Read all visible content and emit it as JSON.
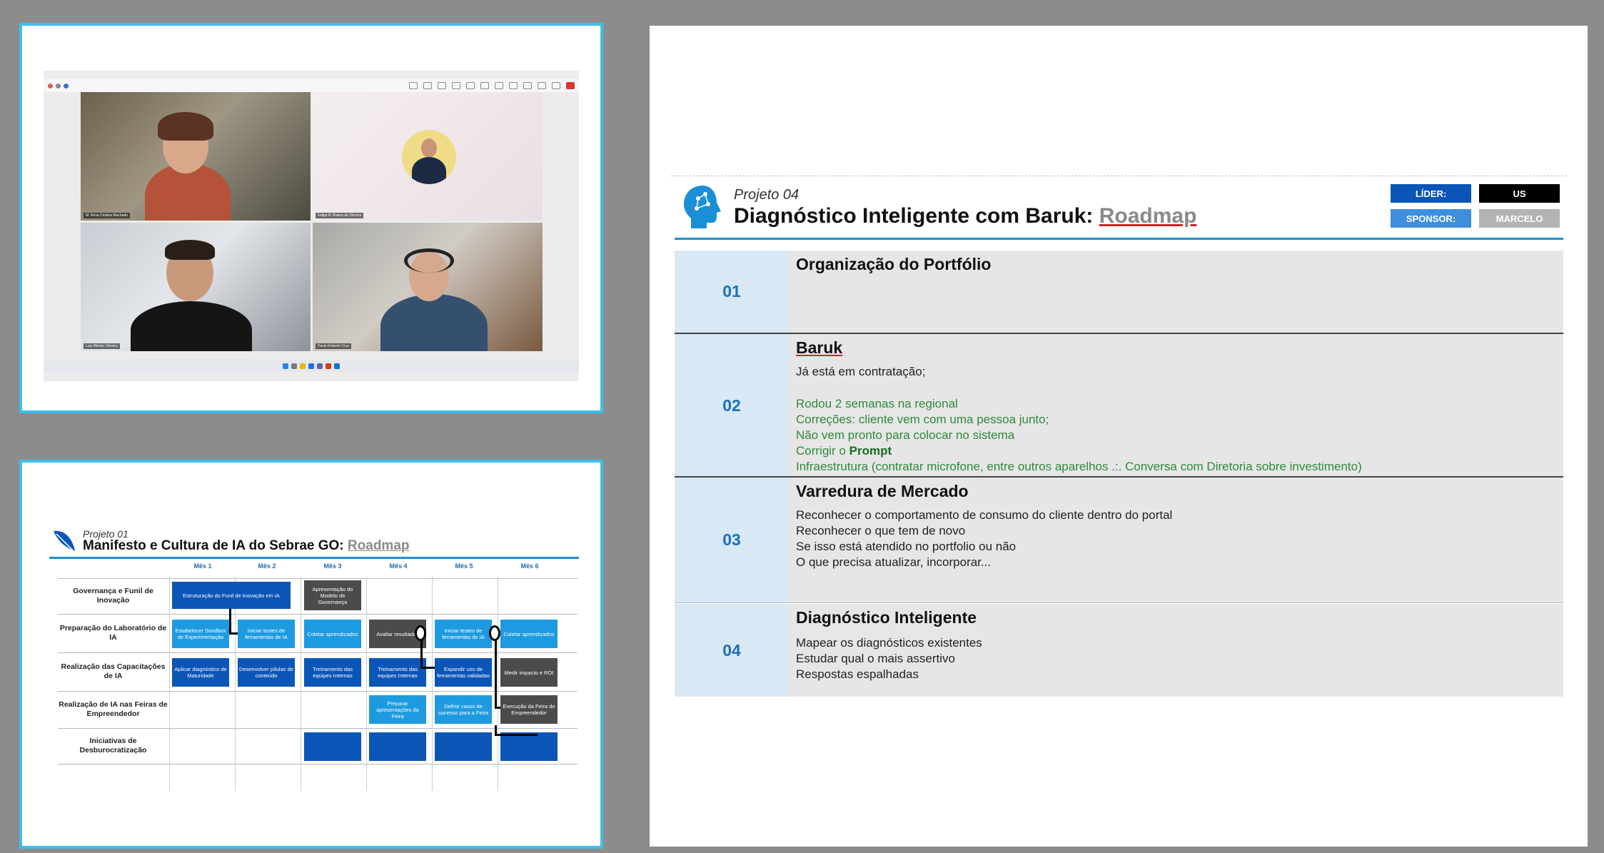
{
  "video_call": {
    "tiles": [
      {
        "label": "M. Rosa Cristina Machado"
      },
      {
        "label": "Felipe R. Bueno de Oliveira"
      },
      {
        "label": "Luis Ribeiro Oliveira"
      },
      {
        "label": "Paulo Roberto Cruz"
      }
    ]
  },
  "roadmap1": {
    "kicker": "Projeto 01",
    "title_main": "Manifesto e Cultura de IA do Sebrae GO: ",
    "title_roadmap": "Roadmap",
    "months": [
      "Mês 1",
      "Mês 2",
      "Mês 3",
      "Mês 4",
      "Mês 5",
      "Mês 6"
    ],
    "rows": [
      "Governança e Funil de Inovação",
      "Preparação do Laboratório de IA",
      "Realização das Capacitações de IA",
      "Realização de IA nas Feiras de Empreendedor",
      "Iniciativas de Desburocratização"
    ],
    "cells": [
      "Estruturação do Funil de Inovação em IA",
      "Apresentação do Modelo de Governança",
      "Estabelecer Sandbox de Experimentação",
      "Iniciar testes de ferramentas de IA",
      "Coletar aprendizados",
      "Avaliar resultados",
      "Iniciar testes de ferramentas de IA",
      "Coletar aprendizados",
      "Aplicar diagnóstico de Maturidade",
      "Desenvolver pílulas de conteúdo",
      "Treinamento das equipes Internas",
      "Treinamento das equipes Internas",
      "Expandir uso de ferramentas validadas",
      "Medir impacto e ROI",
      "Preparar apresentações da Feira",
      "Definir casos de sucesso para a Feira",
      "Execução da Feira do Empreendedor"
    ]
  },
  "slide": {
    "kicker": "Projeto 04",
    "title_main": "Diagnóstico Inteligente com Baruk: ",
    "title_roadmap": "Roadmap",
    "lider_label": "LÍDER:",
    "lider_value": "US",
    "sponsor_label": "SPONSOR:",
    "sponsor_value": "MARCELO",
    "sections": [
      {
        "num": "01",
        "title": "Organização do Portfólio"
      },
      {
        "num": "02",
        "title": "Baruk",
        "line1": "Já está em contratação;",
        "g1": "Rodou 2 semanas na regional",
        "g2": "Correções: cliente vem com uma pessoa junto;",
        "g3": "Não vem pronto para colocar no sistema",
        "g4a": "Corrigir o ",
        "g4b": "Prompt",
        "g5": "Infraestrutura (contratar microfone, entre outros aparelhos .:. Conversa com Diretoria sobre investimento)"
      },
      {
        "num": "03",
        "title": "Varredura de Mercado",
        "l1": "Reconhecer o comportamento de consumo do cliente dentro do portal",
        "l2": "Reconhecer o que tem de novo",
        "l3": "Se isso está atendido no portfolio ou não",
        "l4": "O que precisa atualizar, incorporar..."
      },
      {
        "num": "04",
        "title": "Diagnóstico Inteligente",
        "l1": "Mapear os diagnósticos existentes",
        "l2": "Estudar qual o mais assertivo",
        "l3": "Respostas espalhadas"
      }
    ]
  }
}
